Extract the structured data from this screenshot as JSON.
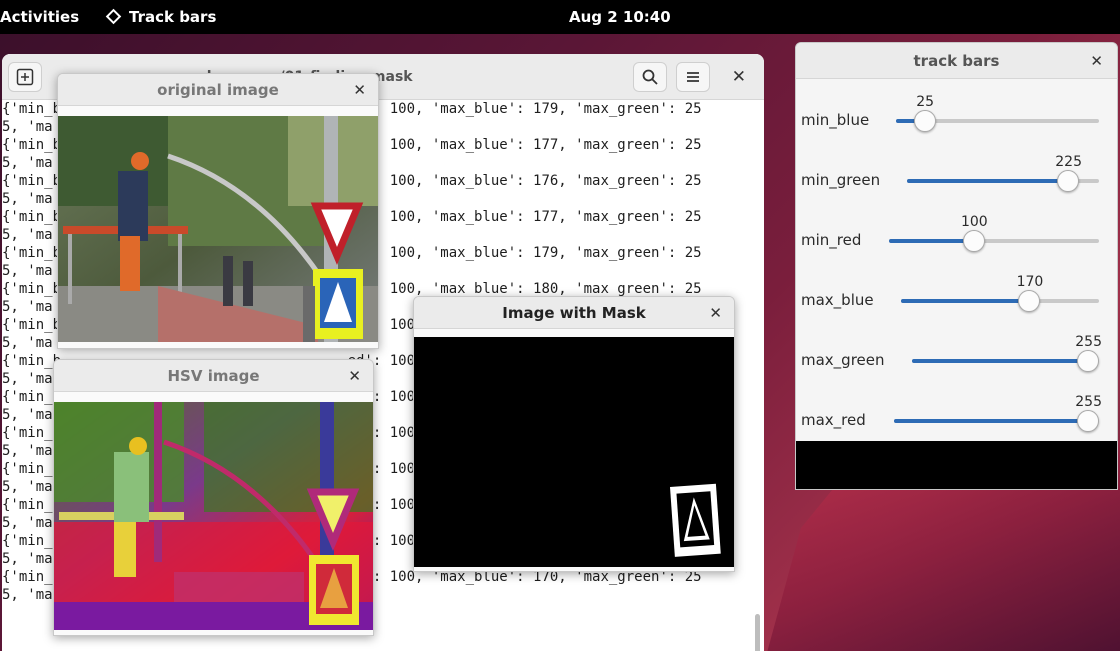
{
  "topbar": {
    "activities": "Activities",
    "app_name": "Track bars",
    "clock": "Aug 2  10:40"
  },
  "terminal": {
    "title": "...yolo-course/01-finding-mask",
    "lines": [
      "{'min_b                                  ed': 100, 'max_blue': 179, 'max_green': 25",
      "5, 'ma",
      "{'min_b                                  ed': 100, 'max_blue': 177, 'max_green': 25",
      "5, 'ma",
      "{'min_b                                  ed': 100, 'max_blue': 176, 'max_green': 25",
      "5, 'ma",
      "{'min_b                                  ed': 100, 'max_blue': 177, 'max_green': 25",
      "5, 'ma",
      "{'min_b                                  ed': 100, 'max_blue': 179, 'max_green': 25",
      "5, 'ma",
      "{'min_b                                  ed': 100, 'max_blue': 180, 'max_green': 25",
      "5, 'ma",
      "{'min_b                                  ed': 100, 'max_blue': 170, 'max_green': 25",
      "5, 'ma",
      "{'min_b                                  ed': 100, 'max_blue': 170, 'max_green': 25",
      "5, 'ma",
      "{'min_b                                  ed': 100, 'max_blue': 170, 'max_green': 25",
      "5, 'ma",
      "{'min_b                                  ed': 100, 'max_blue': 170, 'max_green': 25",
      "5, 'ma",
      "{'min_b                                  ed': 100, 'max_blue': 170, 'max_green': 25",
      "5, 'ma",
      "{'min_b                                  ed': 100, 'max_blue': 170, 'max_green': 25",
      "5, 'ma",
      "{'min_b                                  ed': 100, 'max_blue': 170, 'max_green': 25",
      "5, 'ma",
      "{'min_b                                  ed': 100, 'max_blue': 170, 'max_green': 25",
      "5, 'max_red': 255}"
    ]
  },
  "windows": {
    "original": {
      "title": "original image"
    },
    "hsv": {
      "title": "HSV image"
    },
    "mask": {
      "title": "Image with Mask"
    }
  },
  "trackbars": {
    "title": "track bars",
    "max": 255,
    "items": [
      {
        "label": "min_blue",
        "value": 25
      },
      {
        "label": "min_green",
        "value": 225
      },
      {
        "label": "min_red",
        "value": 100
      },
      {
        "label": "max_blue",
        "value": 170
      },
      {
        "label": "max_green",
        "value": 255
      },
      {
        "label": "max_red",
        "value": 255
      }
    ]
  },
  "colors": {
    "accent": "#2d6bb5",
    "topbar": "#000000"
  },
  "icons": {
    "new_tab": "new-tab-icon",
    "search": "search-icon",
    "menu": "hamburger-menu-icon",
    "close": "close-icon",
    "app": "diamond-icon"
  }
}
